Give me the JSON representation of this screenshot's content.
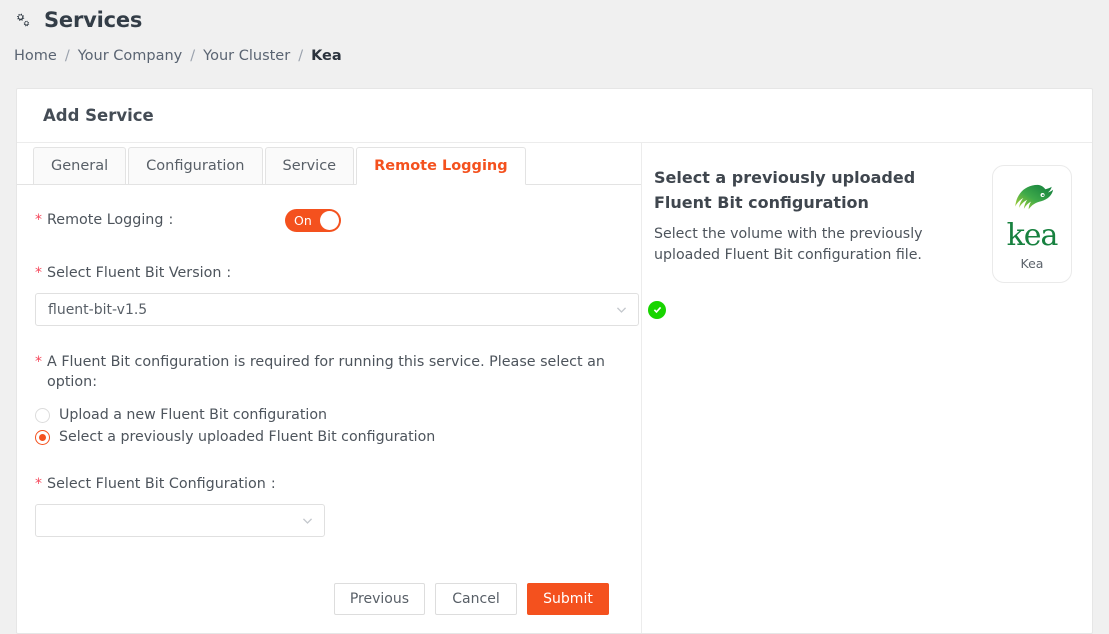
{
  "header": {
    "icon": "cogs-icon",
    "title": "Services"
  },
  "breadcrumb": {
    "separator": "/",
    "items": [
      {
        "label": "Home",
        "current": false
      },
      {
        "label": "Your Company",
        "current": false
      },
      {
        "label": "Your Cluster",
        "current": false
      },
      {
        "label": "Kea",
        "current": true
      }
    ]
  },
  "card": {
    "title": "Add Service"
  },
  "tabs": [
    {
      "label": "General",
      "active": false
    },
    {
      "label": "Configuration",
      "active": false
    },
    {
      "label": "Service",
      "active": false
    },
    {
      "label": "Remote Logging",
      "active": true
    }
  ],
  "form": {
    "remote_logging": {
      "required_mark": "*",
      "label": "Remote Logging",
      "colon": ":",
      "toggle_state": "On"
    },
    "fluent_bit_version": {
      "required_mark": "*",
      "label": "Select Fluent Bit Version",
      "colon": ":",
      "value": "fluent-bit-v1.5",
      "valid": true
    },
    "config_option": {
      "required_mark": "*",
      "label": "A Fluent Bit configuration is required for running this service. Please select an option:",
      "options": [
        {
          "label": "Upload a new Fluent Bit configuration",
          "selected": false
        },
        {
          "label": "Select a previously uploaded Fluent Bit configuration",
          "selected": true
        }
      ]
    },
    "fluent_bit_configuration": {
      "required_mark": "*",
      "label": "Select Fluent Bit Configuration",
      "colon": ":",
      "value": "",
      "placeholder": ""
    }
  },
  "buttons": {
    "previous": "Previous",
    "cancel": "Cancel",
    "submit": "Submit"
  },
  "help": {
    "title": "Select a previously uploaded Fluent Bit configuration",
    "body": "Select the volume with the previously uploaded Fluent Bit configuration file."
  },
  "logo": {
    "wordmark": "kea",
    "caption": "Kea"
  },
  "colors": {
    "accent": "#f4511e",
    "required": "#f5475b",
    "success": "#18d400",
    "logo_green": "#17813f",
    "page_bg": "#f0f0f0"
  }
}
